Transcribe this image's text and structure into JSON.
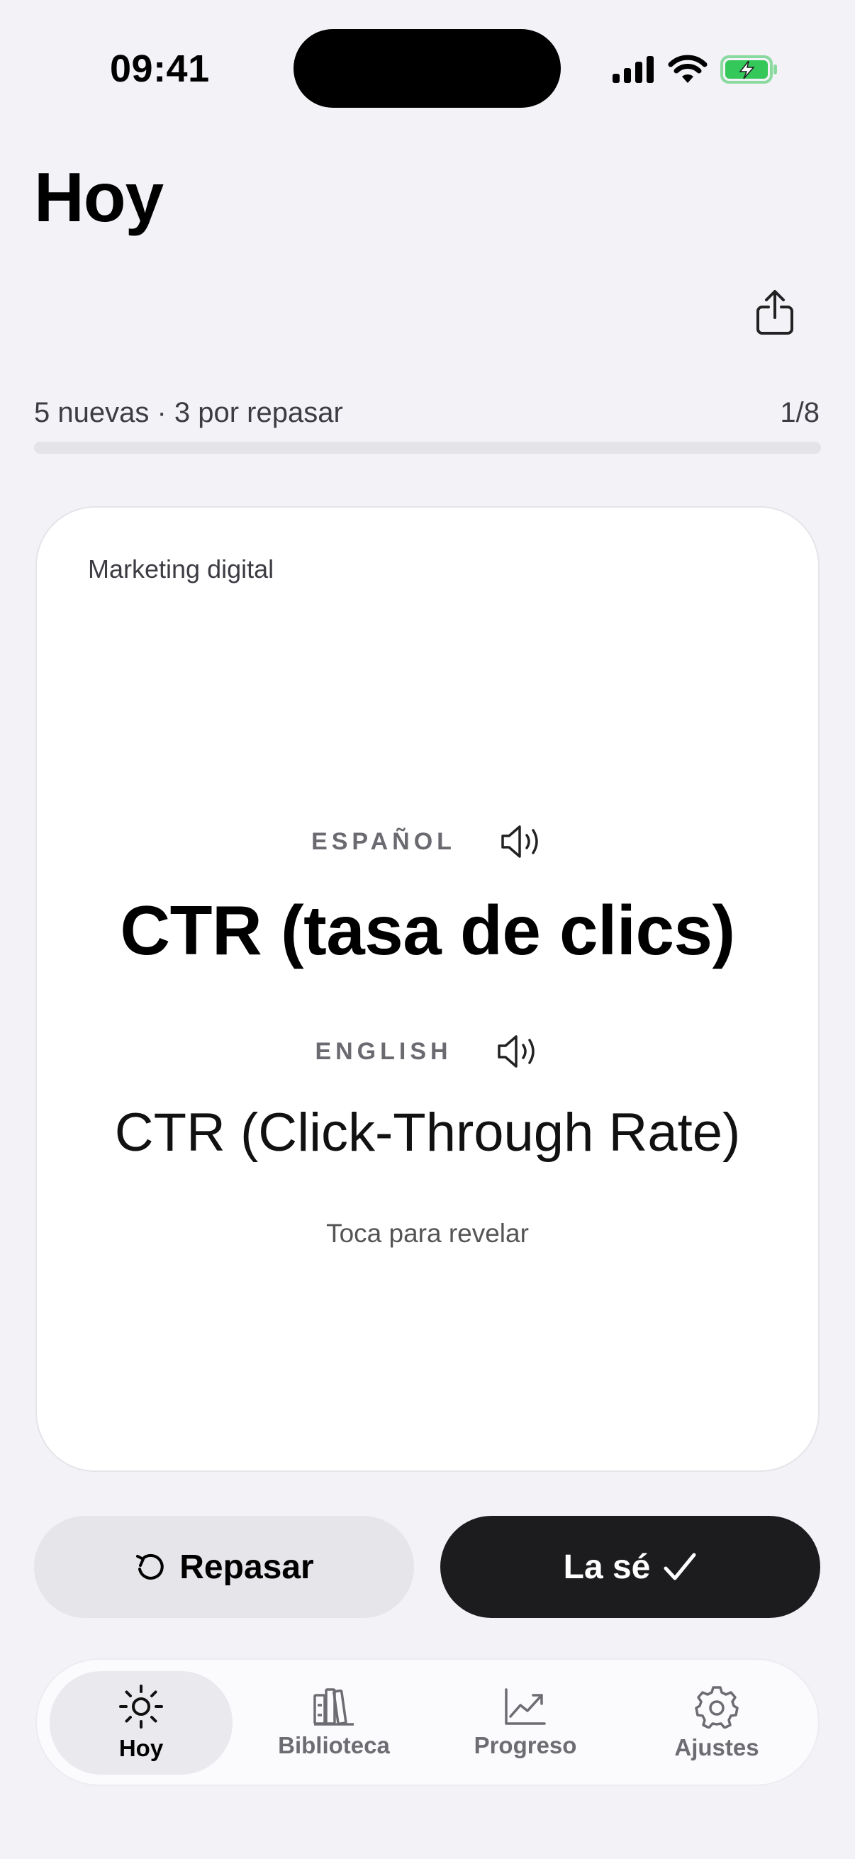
{
  "status_bar": {
    "time": "09:41"
  },
  "header": {
    "title": "Hoy"
  },
  "progress": {
    "label": "5 nuevas · 3 por repasar",
    "count": "1/8",
    "fraction": 0.0
  },
  "card": {
    "category": "Marketing digital",
    "source_language": "ESPAÑOL",
    "source_term": "CTR (tasa de clics)",
    "target_language": "ENGLISH",
    "target_term": "CTR (Click-Through Rate)",
    "hint": "Toca para revelar"
  },
  "actions": {
    "review_label": "Repasar",
    "know_label": "La sé"
  },
  "tabs": [
    {
      "label": "Hoy",
      "icon": "sun-icon",
      "active": true
    },
    {
      "label": "Biblioteca",
      "icon": "books-icon",
      "active": false
    },
    {
      "label": "Progreso",
      "icon": "chart-icon",
      "active": false
    },
    {
      "label": "Ajustes",
      "icon": "gear-icon",
      "active": false
    }
  ],
  "colors": {
    "background": "#f2f2f7",
    "primary_button": "#1c1c1e",
    "secondary_button": "#e5e5ea",
    "battery_green": "#34c759"
  }
}
